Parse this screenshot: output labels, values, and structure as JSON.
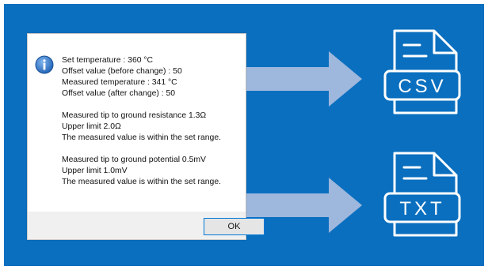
{
  "dialog": {
    "message_lines_group1": [
      "Set temperature : 360 °C",
      "Offset value (before change) : 50",
      "Measured temperature : 341 °C",
      "Offset value (after change) : 50"
    ],
    "message_lines_group2": [
      "Measured tip to ground resistance 1.3Ω",
      "Upper limit 2.0Ω",
      "The measured value is within the set range."
    ],
    "message_lines_group3": [
      "Measured tip to ground potential 0.5mV",
      "Upper limit 1.0mV",
      "The measured value is within the set range."
    ],
    "ok_label": "OK",
    "icon": "info-icon"
  },
  "exports": [
    {
      "format": "CSV",
      "icon": "csv-file-icon"
    },
    {
      "format": "TXT",
      "icon": "txt-file-icon"
    }
  ],
  "colors": {
    "background": "#0a6fbf",
    "arrow": "#9eb7dd",
    "doc_stroke": "#ffffff",
    "ok_border": "#0078d7"
  }
}
